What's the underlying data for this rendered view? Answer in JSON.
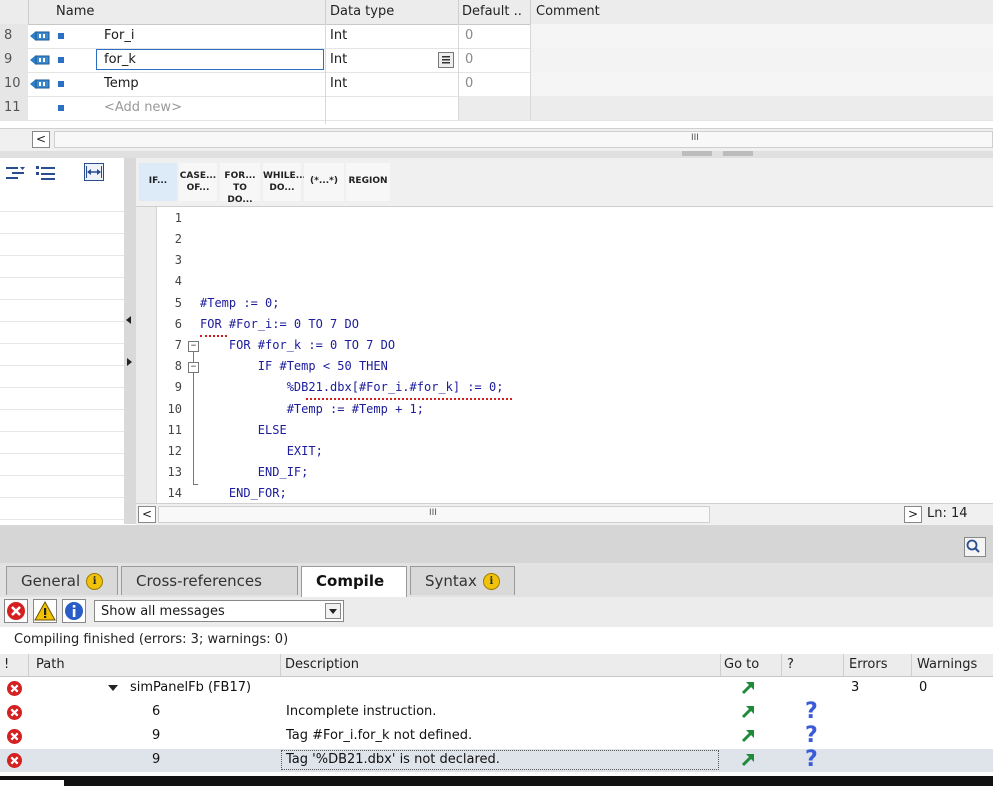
{
  "interface": {
    "columns": {
      "name": "Name",
      "data_type": "Data type",
      "default": "Default ..",
      "comment": "Comment"
    },
    "rows": [
      {
        "num": "8",
        "name": "For_i",
        "type": "Int",
        "default": "0"
      },
      {
        "num": "9",
        "name": "for_k",
        "type": "Int",
        "default": "0"
      },
      {
        "num": "10",
        "name": "Temp",
        "type": "Int",
        "default": "0"
      },
      {
        "num": "11",
        "name": "<Add new>",
        "type": "",
        "default": ""
      }
    ]
  },
  "scroll_center_mark": "III",
  "toolbar": {
    "keywords": [
      {
        "label": "IF...",
        "label2": ""
      },
      {
        "label": "CASE...",
        "label2": "OF..."
      },
      {
        "label": "FOR...",
        "label2": "TO DO..."
      },
      {
        "label": "WHILE...",
        "label2": "DO..."
      },
      {
        "label": "(*...*)",
        "label2": ""
      },
      {
        "label": "REGION",
        "label2": ""
      }
    ]
  },
  "editor": {
    "lines": [
      {
        "n": "1",
        "text": ""
      },
      {
        "n": "2",
        "text": ""
      },
      {
        "n": "3",
        "text": ""
      },
      {
        "n": "4",
        "text": ""
      },
      {
        "n": "5",
        "text": "#Temp := 0;"
      },
      {
        "n": "6",
        "text": "FOR #For_i:= 0 TO 7 DO"
      },
      {
        "n": "7",
        "text": "    FOR #for_k := 0 TO 7 DO"
      },
      {
        "n": "8",
        "text": "        IF #Temp < 50 THEN"
      },
      {
        "n": "9",
        "text": "            %DB21.dbx[#For_i.#for_k] := 0;"
      },
      {
        "n": "10",
        "text": "            #Temp := #Temp + 1;"
      },
      {
        "n": "11",
        "text": "        ELSE"
      },
      {
        "n": "12",
        "text": "            EXIT;"
      },
      {
        "n": "13",
        "text": "        END_IF;"
      },
      {
        "n": "14",
        "text": "    END_FOR;"
      }
    ],
    "line_indicator": "Ln: 14"
  },
  "inspector": {
    "tabs": [
      {
        "label": "General",
        "info": "i"
      },
      {
        "label": "Cross-references",
        "info": ""
      },
      {
        "label": "Compile",
        "info": ""
      },
      {
        "label": "Syntax",
        "info": "i"
      }
    ],
    "filter": "Show all messages",
    "status": "Compiling finished (errors: 3; warnings: 0)",
    "columns": {
      "bang": "!",
      "path": "Path",
      "description": "Description",
      "goto": "Go to",
      "help": "?",
      "errors": "Errors",
      "warnings": "Warnings"
    },
    "messages": [
      {
        "path": "simPanelFb (FB17)",
        "description": "",
        "errors": "3",
        "warnings": "0"
      },
      {
        "path": "6",
        "description": "Incomplete instruction.",
        "errors": "",
        "warnings": ""
      },
      {
        "path": "9",
        "description": "Tag #For_i.for_k not defined.",
        "errors": "",
        "warnings": ""
      },
      {
        "path": "9",
        "description": "Tag '%DB21.dbx' is not declared.",
        "errors": "",
        "warnings": ""
      }
    ]
  },
  "colors": {
    "error": "#d42020",
    "keyword": "#1c1c9c",
    "goto_arrow": "#1f8a3a",
    "help": "#3b5bd8"
  }
}
